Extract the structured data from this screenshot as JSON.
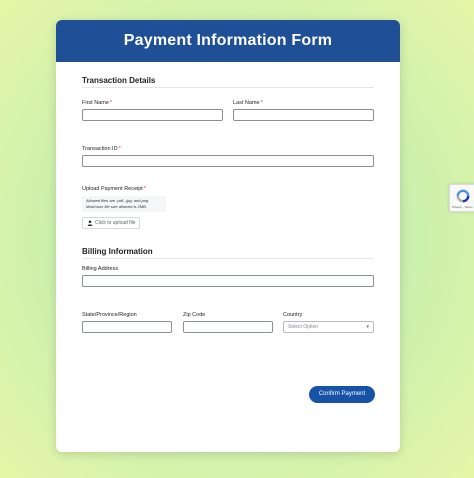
{
  "form": {
    "title": "Payment Information Form",
    "transaction_section": "Transaction Details",
    "first_name_label": "First Name",
    "last_name_label": "Last Name",
    "transaction_id_label": "Transaction ID",
    "upload_label": "Upload Payment Receipt",
    "required_mark": "*",
    "upload_hint_line1": "Allowed files are .pdf, .jpg, and.png",
    "upload_hint_line2": "Maximum file size allowed is 2MB.",
    "upload_button": "Click to upload file",
    "billing_section": "Billing Information",
    "billing_address_label": "Billing Address",
    "state_label": "State/Province/Region",
    "zip_label": "Zip Code",
    "country_label": "Country",
    "country_placeholder": "Select Option",
    "confirm_button": "Confirm Payment"
  },
  "recaptcha": {
    "links": "Privacy - Terms"
  },
  "colors": {
    "header": "#1f4f96",
    "button": "#1653a8"
  }
}
